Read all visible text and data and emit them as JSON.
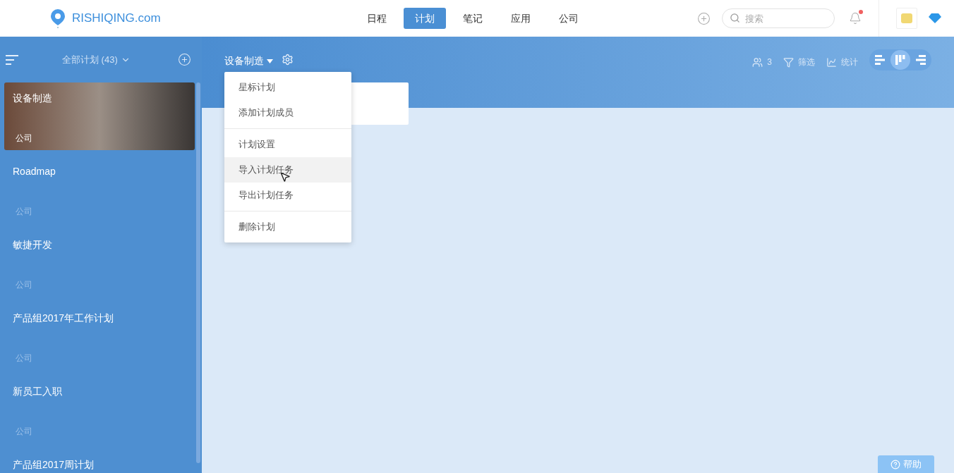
{
  "logo": {
    "text": "RISHIQING.com"
  },
  "nav": [
    {
      "label": "日程",
      "selected": false
    },
    {
      "label": "计划",
      "selected": true
    },
    {
      "label": "笔记",
      "selected": false
    },
    {
      "label": "应用",
      "selected": false
    },
    {
      "label": "公司",
      "selected": false
    }
  ],
  "search": {
    "placeholder": "搜索"
  },
  "notifications": {
    "unread": true
  },
  "sidebar": {
    "title": "全部计划 (43)",
    "plans": [
      {
        "name": "设备制造",
        "group": "公司",
        "selected": true
      },
      {
        "name": "Roadmap",
        "group": "公司",
        "selected": false
      },
      {
        "name": "敏捷开发",
        "group": "公司",
        "selected": false
      },
      {
        "name": "产品组2017年工作计划",
        "group": "公司",
        "selected": false
      },
      {
        "name": "新员工入职",
        "group": "公司",
        "selected": false
      },
      {
        "name": "产品组2017周计划",
        "selected": false
      }
    ]
  },
  "plan_header": {
    "title": "设备制造",
    "members": "3",
    "filter": "筛选",
    "stats": "统计",
    "views": [
      {
        "kind": "gantt",
        "selected": false
      },
      {
        "kind": "board",
        "selected": true
      },
      {
        "kind": "list",
        "selected": false
      }
    ]
  },
  "menu": {
    "groups": [
      [
        {
          "label": "星标计划",
          "hovered": false
        },
        {
          "label": "添加计划成员",
          "hovered": false
        }
      ],
      [
        {
          "label": "计划设置",
          "hovered": false
        },
        {
          "label": "导入计划任务",
          "hovered": true
        },
        {
          "label": "导出计划任务",
          "hovered": false
        }
      ],
      [
        {
          "label": "删除计划",
          "hovered": false
        }
      ]
    ]
  },
  "help": {
    "label": "帮助"
  }
}
